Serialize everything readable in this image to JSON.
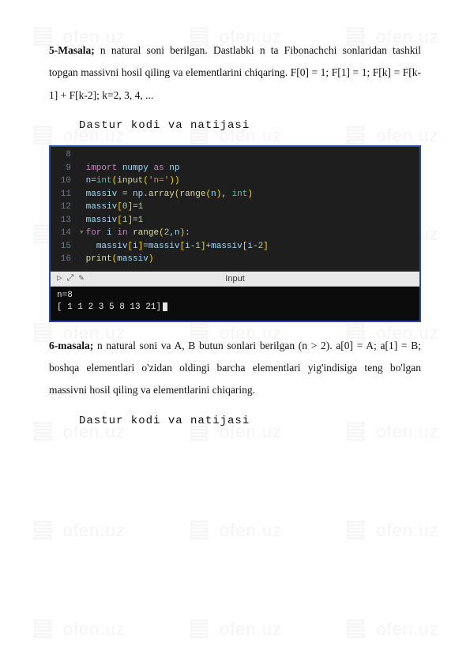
{
  "watermark": {
    "text": "ofen.uz"
  },
  "problem5": {
    "label": "5-Masala;",
    "text": " n natural soni berilgan. Dastlabki n ta Fibonachchi sonlaridan tashkil topgan massivni hosil qiling va elementlarini chiqaring. F[0] = 1; F[1] = 1; F[k] = F[k-1] + F[k-2]; k=2, 3, 4, ..."
  },
  "section_title_1": "Dastur kodi va natijasi",
  "code": {
    "lines": [
      {
        "n": "8",
        "html": ""
      },
      {
        "n": "9",
        "html": "<span class='kw2'>import</span> <span class='mod'>numpy</span> <span class='kw2'>as</span> <span class='mod'>np</span>"
      },
      {
        "n": "10",
        "html": "<span class='ident'>n</span><span class='eq'>=</span><span class='builtin'>int</span><span class='paren'>(</span><span class='func'>input</span><span class='paren'>(</span><span class='str'>'n='</span><span class='paren'>)</span><span class='paren'>)</span>"
      },
      {
        "n": "11",
        "html": "<span class='ident'>massiv</span> <span class='eq'>=</span> <span class='mod'>np</span><span class='op'>.</span><span class='func'>array</span><span class='paren'>(</span><span class='func'>range</span><span class='paren'>(</span><span class='ident'>n</span><span class='paren'>)</span><span class='op'>,</span> <span class='builtin'>int</span><span class='paren'>)</span>"
      },
      {
        "n": "12",
        "html": "<span class='ident'>massiv</span><span class='paren'>[</span><span class='num'>0</span><span class='paren'>]</span><span class='eq'>=</span><span class='num'>1</span>"
      },
      {
        "n": "13",
        "html": "<span class='ident'>massiv</span><span class='paren'>[</span><span class='num'>1</span><span class='paren'>]</span><span class='eq'>=</span><span class='num'>1</span>"
      },
      {
        "n": "14",
        "fold": "▾",
        "html": "<span class='kw2'>for</span> <span class='ident'>i</span> <span class='kw2'>in</span> <span class='func'>range</span><span class='paren'>(</span><span class='num'>2</span><span class='op'>,</span><span class='ident'>n</span><span class='paren'>)</span><span class='op'>:</span>"
      },
      {
        "n": "15",
        "html": "  <span class='ident'>massiv</span><span class='paren'>[</span><span class='ident'>i</span><span class='paren'>]</span><span class='eq'>=</span><span class='ident'>massiv</span><span class='paren'>[</span><span class='ident'>i</span><span class='op'>-</span><span class='num'>1</span><span class='paren'>]</span><span class='op'>+</span><span class='ident'>massiv</span><span class='paren'>[</span><span class='ident'>i</span><span class='op'>-</span><span class='num'>2</span><span class='paren'>]</span>"
      },
      {
        "n": "16",
        "html": "<span class='func'>print</span><span class='paren'>(</span><span class='ident'>massiv</span><span class='paren'>)</span>"
      }
    ],
    "io_label": "Input",
    "io_lines": [
      "n=8",
      "[ 1  1  2  3  5  8 13 21]"
    ]
  },
  "problem6": {
    "label": "6-masala;",
    "text": " n natural soni va A, B butun sonlari berilgan (n > 2). a[0] = A; a[1] = B; boshqa elementlari o'zidan oldingi barcha elementlari yig'indisiga teng bo'lgan massivni hosil qiling va elementlarini chiqaring."
  },
  "section_title_2": "Dastur kodi va natijasi"
}
